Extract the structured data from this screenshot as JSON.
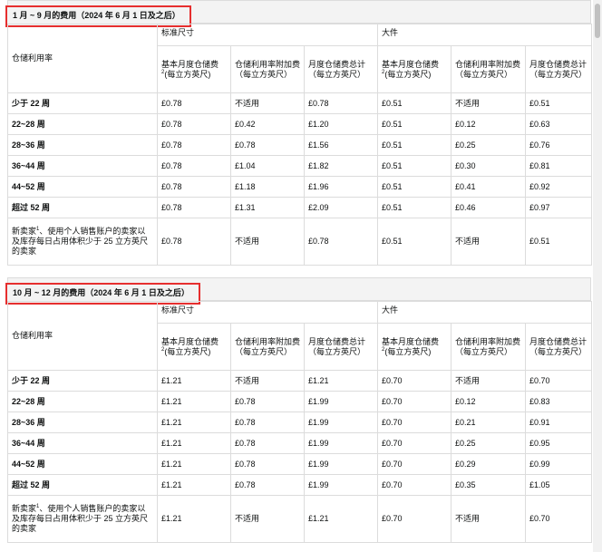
{
  "section1": {
    "title": "1 月 ~ 9 月的费用（2024 年 6 月 1 日及之后）",
    "col_label": "仓储利用率",
    "group_standard": "标准尺寸",
    "group_oversize": "大件",
    "sub_headers": [
      "基本月度仓储费",
      "(每立方英尺)",
      "仓储利用率附加费（每立方英尺）",
      "月度仓储费总计（每立方英尺）",
      "基本月度仓储费",
      "(每立方英尺)",
      "仓储利用率附加费（每立方英尺）",
      "月度仓储费总计（每立方英尺）"
    ],
    "rows": [
      {
        "label": "少于 22 周",
        "cells": [
          "£0.78",
          "不适用",
          "£0.78",
          "£0.51",
          "不适用",
          "£0.51"
        ]
      },
      {
        "label": "22~28 周",
        "cells": [
          "£0.78",
          "£0.42",
          "£1.20",
          "£0.51",
          "£0.12",
          "£0.63"
        ]
      },
      {
        "label": "28~36 周",
        "cells": [
          "£0.78",
          "£0.78",
          "£1.56",
          "£0.51",
          "£0.25",
          "£0.76"
        ]
      },
      {
        "label": "36~44 周",
        "cells": [
          "£0.78",
          "£1.04",
          "£1.82",
          "£0.51",
          "£0.30",
          "£0.81"
        ]
      },
      {
        "label": "44~52 周",
        "cells": [
          "£0.78",
          "£1.18",
          "£1.96",
          "£0.51",
          "£0.41",
          "£0.92"
        ]
      },
      {
        "label": "超过 52 周",
        "cells": [
          "£0.78",
          "£1.31",
          "£2.09",
          "£0.51",
          "£0.46",
          "£0.97"
        ]
      }
    ],
    "new_seller_label": "新卖家",
    "new_seller_label_rest": "、使用个人销售账户的卖家以及库存每日占用体积少于 25 立方英尺的卖家",
    "new_seller_cells": [
      "£0.78",
      "不适用",
      "£0.78",
      "£0.51",
      "不适用",
      "£0.51"
    ]
  },
  "section2": {
    "title": "10 月 ~ 12 月的费用（2024 年 6 月 1 日及之后）",
    "col_label": "仓储利用率",
    "group_standard": "标准尺寸",
    "group_oversize": "大件",
    "sub_headers": [
      "基本月度仓储费",
      "(每立方英尺)",
      "仓储利用率附加费（每立方英尺）",
      "月度仓储费总计（每立方英尺）",
      "基本月度仓储费",
      "(每立方英尺)",
      "仓储利用率附加费（每立方英尺）",
      "月度仓储费总计（每立方英尺）"
    ],
    "rows": [
      {
        "label": "少于 22 周",
        "cells": [
          "£1.21",
          "不适用",
          "£1.21",
          "£0.70",
          "不适用",
          "£0.70"
        ]
      },
      {
        "label": "22~28 周",
        "cells": [
          "£1.21",
          "£0.78",
          "£1.99",
          "£0.70",
          "£0.12",
          "£0.83"
        ]
      },
      {
        "label": "28~36 周",
        "cells": [
          "£1.21",
          "£0.78",
          "£1.99",
          "£0.70",
          "£0.21",
          "£0.91"
        ]
      },
      {
        "label": "36~44 周",
        "cells": [
          "£1.21",
          "£0.78",
          "£1.99",
          "£0.70",
          "£0.25",
          "£0.95"
        ]
      },
      {
        "label": "44~52 周",
        "cells": [
          "£1.21",
          "£0.78",
          "£1.99",
          "£0.70",
          "£0.29",
          "£0.99"
        ]
      },
      {
        "label": "超过 52 周",
        "cells": [
          "£1.21",
          "£0.78",
          "£1.99",
          "£0.70",
          "£0.35",
          "£1.05"
        ]
      }
    ],
    "new_seller_label": "新卖家",
    "new_seller_label_rest": "、使用个人销售账户的卖家以及库存每日占用体积少于 25 立方英尺的卖家",
    "new_seller_cells": [
      "£1.21",
      "不适用",
      "£1.21",
      "£0.70",
      "不适用",
      "£0.70"
    ]
  },
  "footnote_marks": {
    "base_fee": "2",
    "new_seller": "1"
  }
}
